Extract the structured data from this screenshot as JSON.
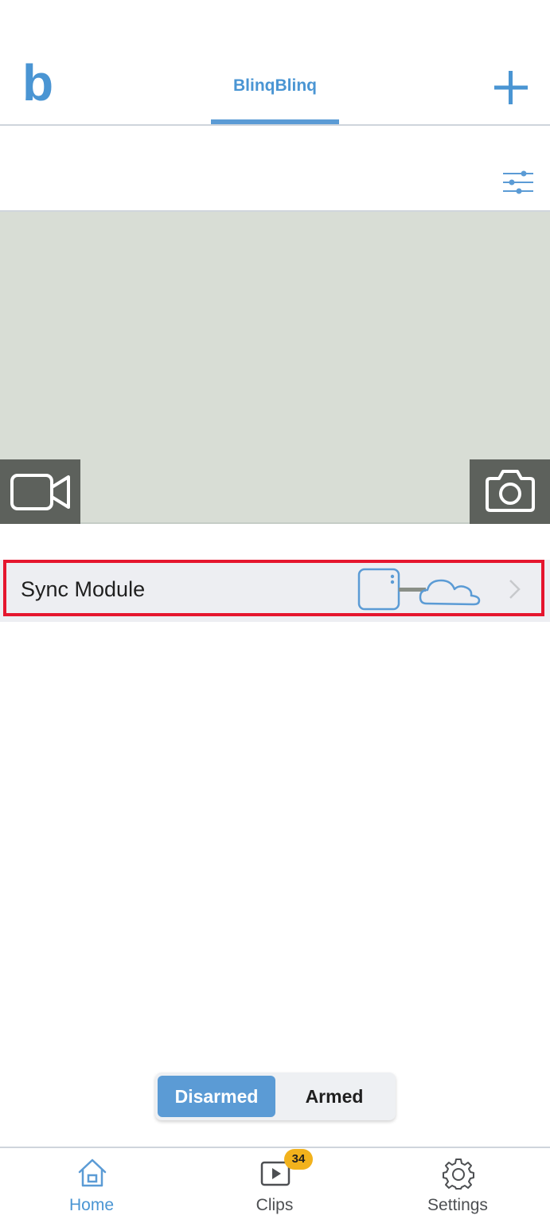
{
  "header": {
    "logo_text": "b",
    "active_tab": "BlinqBlinq",
    "add_icon": "plus-icon"
  },
  "filter_icon": "sliders-icon",
  "camera": {
    "live_view_icon": "video-camera-icon",
    "snapshot_icon": "camera-icon"
  },
  "sync_module": {
    "label": "Sync Module",
    "status_icon": "sync-module-cloud-icon",
    "chevron_icon": "chevron-right-icon"
  },
  "arm_toggle": {
    "disarmed_label": "Disarmed",
    "armed_label": "Armed",
    "selected": "Disarmed"
  },
  "bottom_nav": {
    "items": [
      {
        "label": "Home",
        "icon": "home-icon",
        "active": true
      },
      {
        "label": "Clips",
        "icon": "play-icon",
        "badge": "34"
      },
      {
        "label": "Settings",
        "icon": "gear-icon"
      }
    ]
  },
  "colors": {
    "accent": "#5b9bd5",
    "highlight": "#e5162e",
    "badge": "#f2b21c",
    "camera_placeholder": "#d8ddd5"
  }
}
